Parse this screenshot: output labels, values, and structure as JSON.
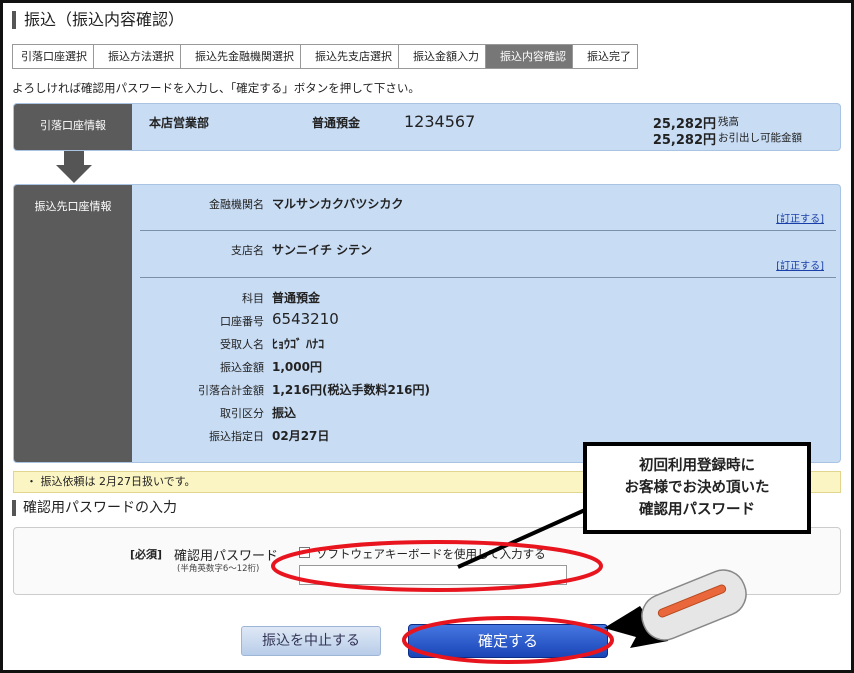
{
  "page": {
    "title": "振込（振込内容確認）"
  },
  "steps": [
    {
      "label": "引落口座選択",
      "active": false
    },
    {
      "label": "振込方法選択",
      "active": false
    },
    {
      "label": "振込先金融機関選択",
      "active": false
    },
    {
      "label": "振込先支店選択",
      "active": false
    },
    {
      "label": "振込金額入力",
      "active": false
    },
    {
      "label": "振込内容確認",
      "active": true
    },
    {
      "label": "振込完了",
      "active": false
    }
  ],
  "instruction": "よろしければ確認用パスワードを入力し、「確定する」ボタンを押して下さい。",
  "source": {
    "label": "引落口座情報",
    "branch": "本店営業部",
    "type": "普通預金",
    "account": "1234567",
    "balance": "25,282円",
    "balance_label": "残高",
    "available": "25,282円",
    "available_label": "お引出し可能金額"
  },
  "dest": {
    "label": "振込先口座情報",
    "fix_label": "[訂正する]",
    "rows": {
      "bank_label": "金融機関名",
      "bank": "マルサンカクバツシカク",
      "branch_label": "支店名",
      "branch": "サンニイチ シテン",
      "type_label": "科目",
      "type": "普通預金",
      "number_label": "口座番号",
      "number": "6543210",
      "payee_label": "受取人名",
      "payee": "ﾋｮｳｺﾞ ﾊﾅｺ",
      "amount_label": "振込金額",
      "amount": "1,000円",
      "total_label": "引落合計金額",
      "total": "1,216円(税込手数料216円)",
      "kind_label": "取引区分",
      "kind": "振込",
      "date_label": "振込指定日",
      "date": "02月27日"
    }
  },
  "note": "・ 振込依頼は 2月27日扱いです。",
  "password": {
    "section_title": "確認用パスワードの入力",
    "required": "[必須]",
    "label": "確認用パスワード",
    "hint": "(半角英数字6～12桁)",
    "keyboard_label": "ソフトウェアキーボードを使用して入力する"
  },
  "buttons": {
    "cancel": "振込を中止する",
    "confirm": "確定する"
  },
  "callout": {
    "line1": "初回利用登録時に",
    "line2": "お客様でお決め頂いた",
    "line3": "確認用パスワード"
  },
  "colors": {
    "highlight_red": "#e8141e",
    "confirm_blue": "#1a45b8",
    "panel_blue": "#c8dcf4"
  }
}
